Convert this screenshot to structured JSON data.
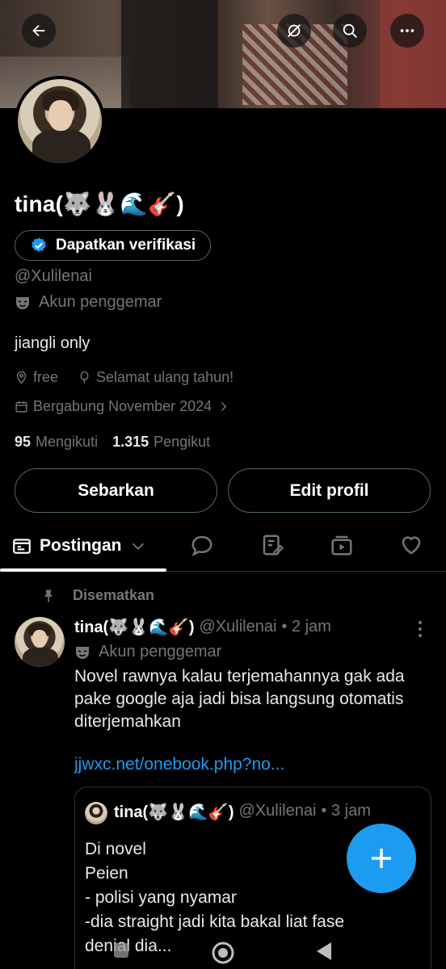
{
  "header": {
    "back_icon": "arrow-left-icon",
    "grok_icon": "grok-icon",
    "search_icon": "search-icon",
    "more_icon": "more-horizontal-icon"
  },
  "profile": {
    "name": "tina(🐺🐰🌊🎸)",
    "verify_label": "Dapatkan verifikasi",
    "handle": "@Xulilenai",
    "account_type": "Akun penggemar",
    "bio": "jiangli only",
    "location": "free",
    "birthday": "Selamat ulang tahun!",
    "joined": "Bergabung November 2024",
    "following_count": "95",
    "following_label": "Mengikuti",
    "followers_count": "1.315",
    "followers_label": "Pengikut",
    "share_label": "Sebarkan",
    "edit_label": "Edit profil"
  },
  "tabs": {
    "active_label": "Postingan",
    "icons": [
      "reply-icon",
      "highlights-icon",
      "media-icon",
      "likes-icon"
    ]
  },
  "post": {
    "pinned_label": "Disematkan",
    "author_name": "tina(🐺🐰🌊🎸)",
    "author_handle": "@Xulilenai",
    "time": "• 2 jam",
    "account_type": "Akun penggemar",
    "text": "Novel rawnya kalau terjemahannya gak ada pake google aja jadi bisa langsung otomatis diterjemahkan",
    "link": "jjwxc.net/onebook.php?no...",
    "quote": {
      "author_name": "tina(🐺🐰🌊🎸)",
      "author_handle": "@Xulilenai",
      "time": "• 3 jam",
      "text": "Di novel\nPeien\n- polisi yang nyamar\n-dia straight jadi kita bakal liat fase\ndenial dia..."
    }
  },
  "colors": {
    "accent": "#1d9bf0",
    "muted": "#71767b",
    "border": "#2f3336",
    "background": "#000000"
  }
}
